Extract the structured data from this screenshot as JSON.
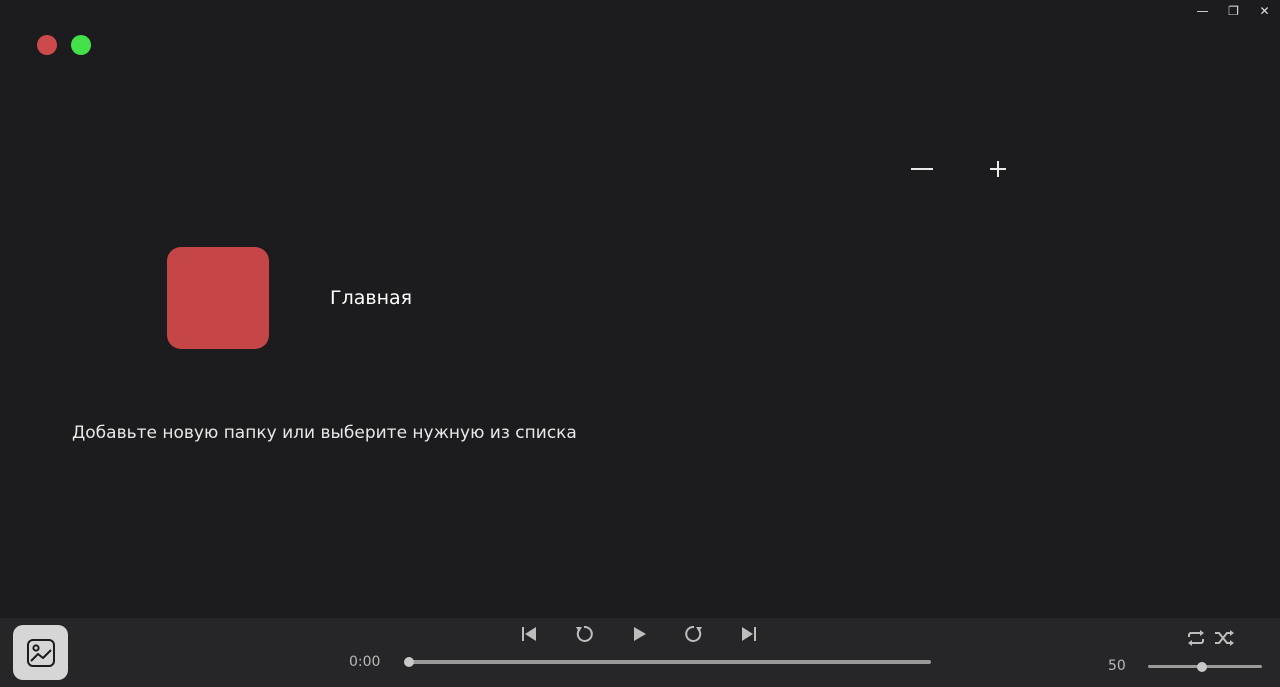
{
  "window": {
    "minimize_glyph": "—",
    "restore_glyph": "❐",
    "close_glyph": "✕",
    "dot_colors": {
      "red": "#cc4a4c",
      "green": "#44e04a"
    }
  },
  "zoom": {
    "minus_icon": "minus-icon",
    "plus_icon": "plus-icon"
  },
  "folder": {
    "title": "Главная",
    "tile_color": "#c64547"
  },
  "main": {
    "hint": "Добавьте новую папку или выберите нужную из списка"
  },
  "player": {
    "cover_icon": "image-icon",
    "controls": [
      "skip-back-icon",
      "rewind-icon",
      "play-icon",
      "forward-icon",
      "skip-forward-icon"
    ],
    "modes": [
      "repeat-icon",
      "shuffle-icon"
    ],
    "current_time": "0:00",
    "progress": 0,
    "volume": "50",
    "volume_fraction": 0.47
  }
}
